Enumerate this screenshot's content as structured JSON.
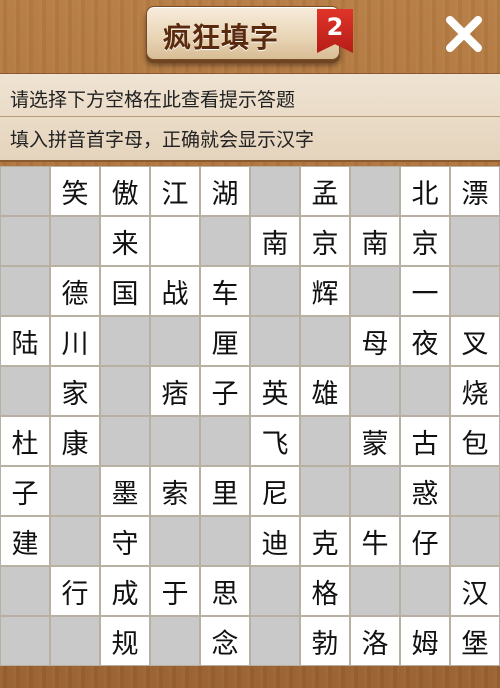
{
  "header": {
    "title": "疯狂填字",
    "level_badge": "2",
    "close_icon": "close-icon"
  },
  "hints": {
    "line1": "请选择下方空格在此查看提示答题",
    "line2": "填入拼音首字母，正确就会显示汉字"
  },
  "colors": {
    "wood": "#a8703c",
    "blocked_cell": "#c9c9c9",
    "open_cell": "#ffffff",
    "badge": "#d0281f",
    "title_text": "#5a2a0e"
  },
  "grid": {
    "rows": [
      [
        "#",
        "笑",
        "傲",
        "江",
        "湖",
        "#",
        "孟",
        "#",
        "北",
        "漂"
      ],
      [
        "#",
        "#",
        "来",
        "",
        "#",
        "南",
        "京",
        "南",
        "京",
        "#"
      ],
      [
        "#",
        "德",
        "国",
        "战",
        "车",
        "#",
        "辉",
        "#",
        "一",
        "#"
      ],
      [
        "陆",
        "川",
        "#",
        "#",
        "厘",
        "#",
        "#",
        "母",
        "夜",
        "叉"
      ],
      [
        "#",
        "家",
        "#",
        "痞",
        "子",
        "英",
        "雄",
        "#",
        "#",
        "烧"
      ],
      [
        "杜",
        "康",
        "#",
        "#",
        "#",
        "飞",
        "#",
        "蒙",
        "古",
        "包"
      ],
      [
        "子",
        "#",
        "墨",
        "索",
        "里",
        "尼",
        "#",
        "#",
        "惑",
        "#"
      ],
      [
        "建",
        "#",
        "守",
        "#",
        "#",
        "迪",
        "克",
        "牛",
        "仔",
        "#"
      ],
      [
        "#",
        "行",
        "成",
        "于",
        "思",
        "#",
        "格",
        "#",
        "#",
        "汉"
      ],
      [
        "#",
        "#",
        "规",
        "#",
        "念",
        "#",
        "勃",
        "洛",
        "姆",
        "堡"
      ]
    ]
  }
}
